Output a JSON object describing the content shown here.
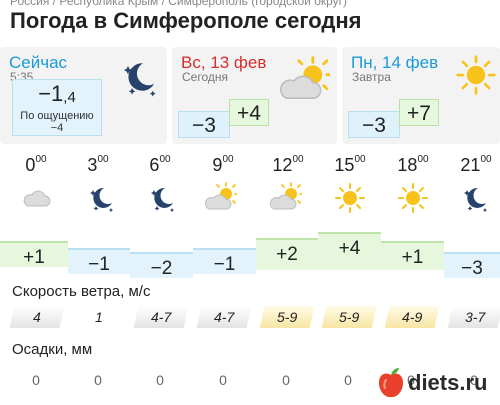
{
  "breadcrumb": "Россия / Республика Крым / Симферополь (городской округ)",
  "title": "Погода в Симферополе сегодня",
  "now": {
    "label": "Сейчас",
    "time": "5:35",
    "temp_int": "−1",
    "temp_frac": ",4",
    "feels_label": "По ощущению",
    "feels_value": "−4",
    "icon": "moon-stars-icon"
  },
  "today": {
    "day": "Вс, 13 фев",
    "sub": "Сегодня",
    "min": "−3",
    "max": "+4",
    "icon": "partly-cloudy-icon"
  },
  "tomorrow": {
    "day": "Пн, 14 фев",
    "sub": "Завтра",
    "min": "−3",
    "max": "+7",
    "icon": "sun-icon"
  },
  "hourly": [
    {
      "h": "0",
      "m": "00",
      "icon": "cloud-icon",
      "temp": "+1"
    },
    {
      "h": "3",
      "m": "00",
      "icon": "moon-stars-icon",
      "temp": "−1"
    },
    {
      "h": "6",
      "m": "00",
      "icon": "moon-stars-icon",
      "temp": "−2"
    },
    {
      "h": "9",
      "m": "00",
      "icon": "partly-cloudy-icon",
      "temp": "−1"
    },
    {
      "h": "12",
      "m": "00",
      "icon": "partly-cloudy-icon",
      "temp": "+2"
    },
    {
      "h": "15",
      "m": "00",
      "icon": "sun-icon",
      "temp": "+4"
    },
    {
      "h": "18",
      "m": "00",
      "icon": "sun-icon",
      "temp": "+1"
    },
    {
      "h": "21",
      "m": "00",
      "icon": "moon-stars-icon",
      "temp": "−3"
    }
  ],
  "wind_label": "Скорость ветра, м/с",
  "wind": [
    "4",
    "1",
    "4-7",
    "4-7",
    "5-9",
    "5-9",
    "4-9",
    "3-7"
  ],
  "precip_label": "Осадки, мм",
  "precip": [
    "0",
    "0",
    "0",
    "0",
    "0",
    "0",
    "0",
    "0"
  ],
  "watermark": "diets.ru",
  "colors": {
    "now_blue": "#1a9bd7",
    "today_red": "#d32f2f",
    "tomorrow_blue": "#1a9bd7",
    "cold_bg": "#e2f3fb",
    "warm_bg": "#e6f7dd",
    "sun": "#f7c31b",
    "moon": "#27436b"
  }
}
